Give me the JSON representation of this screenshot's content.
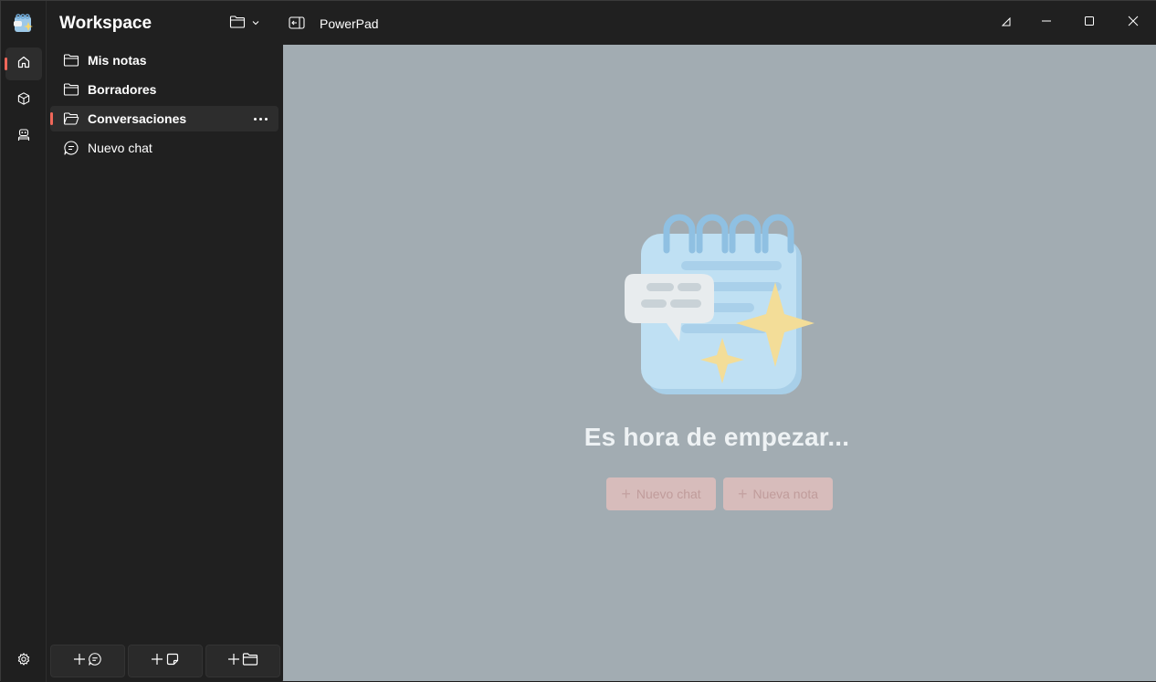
{
  "sidebar": {
    "title": "Workspace",
    "items": [
      {
        "label": "Mis notas",
        "icon": "folder-icon"
      },
      {
        "label": "Borradores",
        "icon": "folder-icon"
      },
      {
        "label": "Conversaciones",
        "icon": "folder-open-icon"
      },
      {
        "label": "Nuevo chat",
        "icon": "chat-icon"
      }
    ]
  },
  "titlebar": {
    "title": "PowerPad"
  },
  "main": {
    "heading": "Es hora de empezar...",
    "new_chat_label": "Nuevo chat",
    "new_note_label": "Nueva nota"
  },
  "colors": {
    "accent": "#f0675a",
    "main_bg": "#a2acb2",
    "button_bg": "#d7bcbb"
  }
}
